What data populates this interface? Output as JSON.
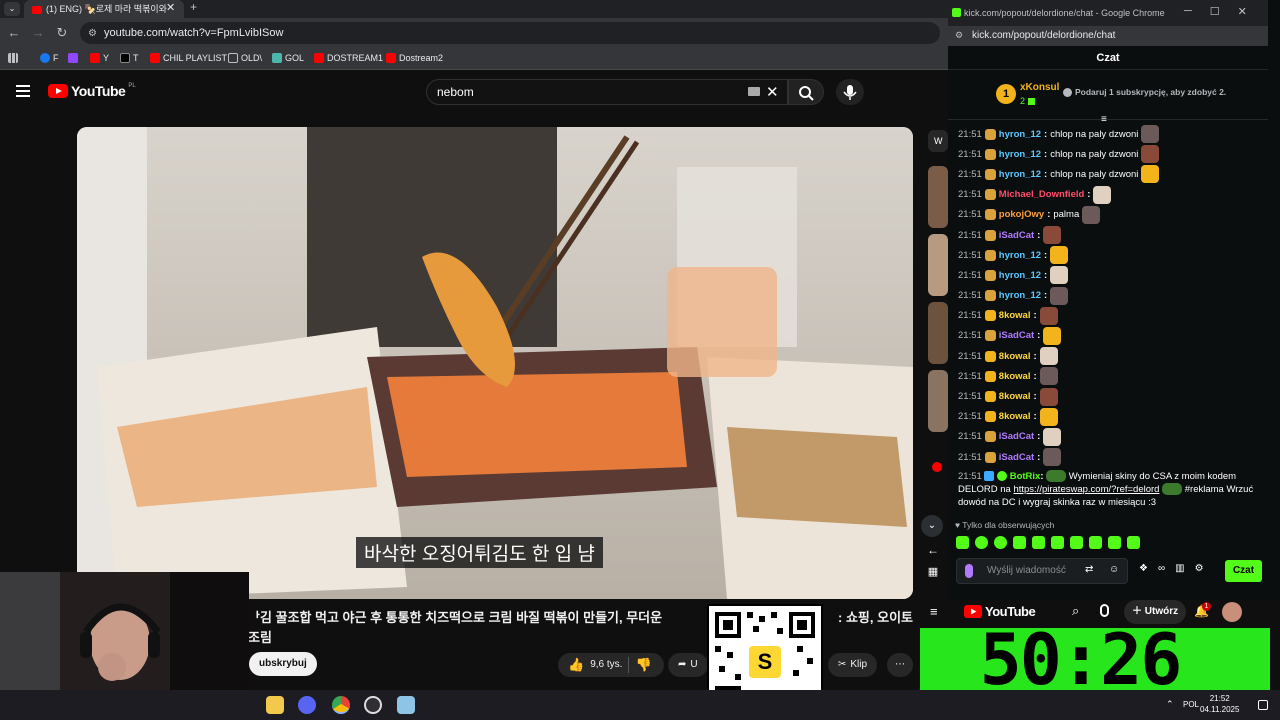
{
  "browser": {
    "tab_title": "(1) ENG) 🍢로제 마라 떡볶이와",
    "address": "youtube.com/watch?v=FpmLvibISow",
    "bookmarks": [
      "F",
      "",
      "Y",
      "T",
      "CHIL PLAYLIST",
      "OLD\\",
      "GOL",
      "DOSTREAM1",
      "Dostream2"
    ]
  },
  "youtube": {
    "logo_text": "YouTube",
    "logo_region": "PL",
    "search_value": "nebom",
    "subtitle": "바삭한 오징어튀김도 한 입 냠",
    "title_line1": "ᅡ김 꿀조합 먹고 야근 후 통통한 치즈떡으로 크림 바질 떡볶이 만들기, 무더운",
    "title_line1_end": ": 쇼핑, 오이토",
    "title_line2": "조림",
    "subscribe_label": "ubskrybuj",
    "likes": "9,6 tys.",
    "share_label": "U",
    "clip_label": "Klip",
    "side_label": "W"
  },
  "kick": {
    "window_title": "kick.com/popout/delordione/chat - Google Chrome",
    "url": "kick.com/popout/delordione/chat",
    "header": "Czat",
    "gifter_name": "xKonsul",
    "gifter_count": "2",
    "gift_rank": "1",
    "gift_cta": "Podaruj 1 subskrypcję, aby zdobyć 2.",
    "messages": [
      {
        "time": "21:51",
        "user": "hyron_12",
        "color": "#5cc8ff",
        "text": "chlop na paly dzwoni",
        "emote": true
      },
      {
        "time": "21:51",
        "user": "hyron_12",
        "color": "#5cc8ff",
        "text": "chlop na paly dzwoni",
        "emote": true
      },
      {
        "time": "21:51",
        "user": "hyron_12",
        "color": "#5cc8ff",
        "text": "chlop na paly dzwoni",
        "emote": true
      },
      {
        "time": "21:51",
        "user": "Michael_Downfield",
        "color": "#ff4d6a",
        "text": "",
        "emote": true
      },
      {
        "time": "21:51",
        "user": "pokojOwy",
        "color": "#ff9e3d",
        "text": "palma",
        "emote": true
      },
      {
        "time": "21:51",
        "user": "iSadCat",
        "color": "#b27bff",
        "text": "",
        "emote": true
      },
      {
        "time": "21:51",
        "user": "hyron_12",
        "color": "#5cc8ff",
        "text": "",
        "emote": true
      },
      {
        "time": "21:51",
        "user": "hyron_12",
        "color": "#5cc8ff",
        "text": "",
        "emote": true
      },
      {
        "time": "21:51",
        "user": "hyron_12",
        "color": "#5cc8ff",
        "text": "",
        "emote": true
      },
      {
        "time": "21:51",
        "user": "8kowal",
        "color": "#ffd83d",
        "text": "",
        "emote": true
      },
      {
        "time": "21:51",
        "user": "iSadCat",
        "color": "#b27bff",
        "text": "",
        "emote": true
      },
      {
        "time": "21:51",
        "user": "8kowal",
        "color": "#ffd83d",
        "text": "",
        "emote": true
      },
      {
        "time": "21:51",
        "user": "8kowal",
        "color": "#ffd83d",
        "text": "",
        "emote": true
      },
      {
        "time": "21:51",
        "user": "8kowal",
        "color": "#ffd83d",
        "text": "",
        "emote": true
      },
      {
        "time": "21:51",
        "user": "8kowal",
        "color": "#ffd83d",
        "text": "",
        "emote": true
      },
      {
        "time": "21:51",
        "user": "iSadCat",
        "color": "#b27bff",
        "text": "",
        "emote": true
      },
      {
        "time": "21:51",
        "user": "iSadCat",
        "color": "#b27bff",
        "text": "",
        "emote": true
      }
    ],
    "bot": {
      "time": "21:51",
      "user": "BotRix",
      "text_a": "Wymieniaj skiny do CSA z moim kodem DELORD na",
      "link": "https://pirateswap.com/?ref=delord",
      "text_b": "#reklama Wrzuć dowód na DC i wygraj skinka raz w miesiącu :3"
    },
    "followers_only": "Tylko dla obserwujących",
    "input_placeholder": "Wyślij wiadomość",
    "send_label": "Czat"
  },
  "mini_youtube": {
    "logo_text": "YouTube",
    "create_label": "Utwórz",
    "notif_count": "1"
  },
  "timer": "50:26",
  "system": {
    "lang": "POL",
    "time": "21:52",
    "date": "04.11.2025"
  }
}
